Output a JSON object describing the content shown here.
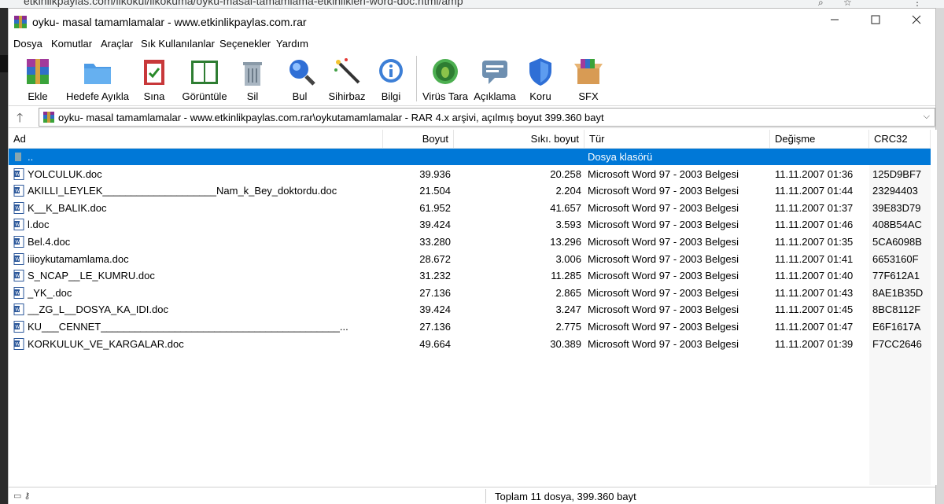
{
  "browser": {
    "url": "etkinlikpaylas.com/ilkokul/ilkokuma/oyku-masal-tamamlama-etkinlikleri-word-doc.html/amp"
  },
  "window": {
    "title": "oyku- masal tamamlamalar - www.etkinlikpaylas.com.rar"
  },
  "menu": [
    "Dosya",
    "Komutlar",
    "Araçlar",
    "Sık Kullanılanlar",
    "Seçenekler",
    "Yardım"
  ],
  "toolbar": {
    "add": "Ekle",
    "extract": "Hedefe Ayıkla",
    "test": "Sına",
    "view": "Görüntüle",
    "delete": "Sil",
    "find": "Bul",
    "wizard": "Sihirbaz",
    "info": "Bilgi",
    "virus": "Virüs Tara",
    "comment": "Açıklama",
    "protect": "Koru",
    "sfx": "SFX"
  },
  "path": {
    "text": "oyku- masal tamamlamalar - www.etkinlikpaylas.com.rar\\oykutamamlamalar - RAR 4.x arşivi, açılmış boyut 399.360 bayt"
  },
  "columns": {
    "name": "Ad",
    "size": "Boyut",
    "packed": "Sıkı. boyut",
    "type": "Tür",
    "modified": "Değişme",
    "crc": "CRC32"
  },
  "parent_row": {
    "name": "..",
    "type": "Dosya klasörü"
  },
  "files": [
    {
      "name": "YOLCULUK.doc",
      "size": "39.936",
      "packed": "20.258",
      "type": "Microsoft Word 97 - 2003 Belgesi",
      "modified": "11.11.2007 01:36",
      "crc": "125D9BF7"
    },
    {
      "name": "AKILLI_LEYLEK____________________Nam_k_Bey_doktordu.doc",
      "size": "21.504",
      "packed": "2.204",
      "type": "Microsoft Word 97 - 2003 Belgesi",
      "modified": "11.11.2007 01:44",
      "crc": "23294403"
    },
    {
      "name": "K__K_BALIK.doc",
      "size": "61.952",
      "packed": "41.657",
      "type": "Microsoft Word 97 - 2003 Belgesi",
      "modified": "11.11.2007 01:37",
      "crc": "39E83D79"
    },
    {
      "name": "l.doc",
      "size": "39.424",
      "packed": "3.593",
      "type": "Microsoft Word 97 - 2003 Belgesi",
      "modified": "11.11.2007 01:46",
      "crc": "408B54AC"
    },
    {
      "name": "Bel.4.doc",
      "size": "33.280",
      "packed": "13.296",
      "type": "Microsoft Word 97 - 2003 Belgesi",
      "modified": "11.11.2007 01:35",
      "crc": "5CA6098B"
    },
    {
      "name": "iiioykutamamlama.doc",
      "size": "28.672",
      "packed": "3.006",
      "type": "Microsoft Word 97 - 2003 Belgesi",
      "modified": "11.11.2007 01:41",
      "crc": "6653160F"
    },
    {
      "name": "S_NCAP__LE_KUMRU.doc",
      "size": "31.232",
      "packed": "11.285",
      "type": "Microsoft Word 97 - 2003 Belgesi",
      "modified": "11.11.2007 01:40",
      "crc": "77F612A1"
    },
    {
      "name": "_YK_.doc",
      "size": "27.136",
      "packed": "2.865",
      "type": "Microsoft Word 97 - 2003 Belgesi",
      "modified": "11.11.2007 01:43",
      "crc": "8AE1B35D"
    },
    {
      "name": "__ZG_L__DOSYA_KA_IDI.doc",
      "size": "39.424",
      "packed": "3.247",
      "type": "Microsoft Word 97 - 2003 Belgesi",
      "modified": "11.11.2007 01:45",
      "crc": "8BC8112F"
    },
    {
      "name": "KU___CENNET__________________________________________...",
      "size": "27.136",
      "packed": "2.775",
      "type": "Microsoft Word 97 - 2003 Belgesi",
      "modified": "11.11.2007 01:47",
      "crc": "E6F1617A"
    },
    {
      "name": "KORKULUK_VE_KARGALAR.doc",
      "size": "49.664",
      "packed": "30.389",
      "type": "Microsoft Word 97 - 2003 Belgesi",
      "modified": "11.11.2007 01:39",
      "crc": "F7CC2646"
    }
  ],
  "status": {
    "total": "Toplam 11 dosya, 399.360 bayt"
  }
}
